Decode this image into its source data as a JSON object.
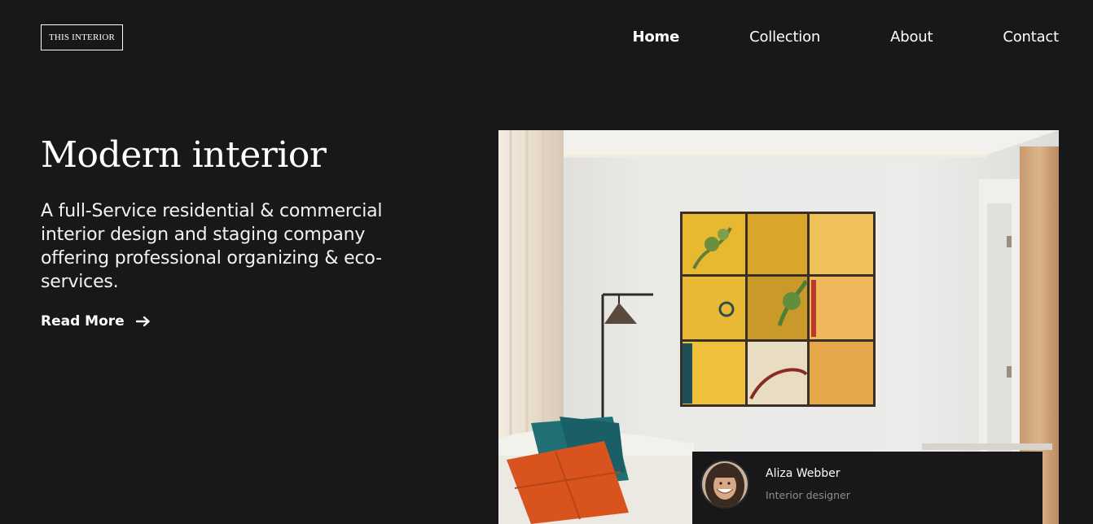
{
  "logo": {
    "text": "THIS INTERIOR"
  },
  "nav": {
    "items": [
      {
        "label": "Home",
        "active": true
      },
      {
        "label": "Collection",
        "active": false
      },
      {
        "label": "About",
        "active": false
      },
      {
        "label": "Contact",
        "active": false
      }
    ]
  },
  "hero": {
    "title": "Modern interior",
    "description": "A full-Service residential & commercial interior design and staging company offering professional organizing & eco-services.",
    "cta_label": "Read More",
    "cta_icon": "arrow-right-icon"
  },
  "designer_card": {
    "name": "Aliza Webber",
    "role": "Interior designer"
  },
  "colors": {
    "background": "#18181b",
    "text": "#ffffff",
    "muted": "#8e8e8e"
  }
}
